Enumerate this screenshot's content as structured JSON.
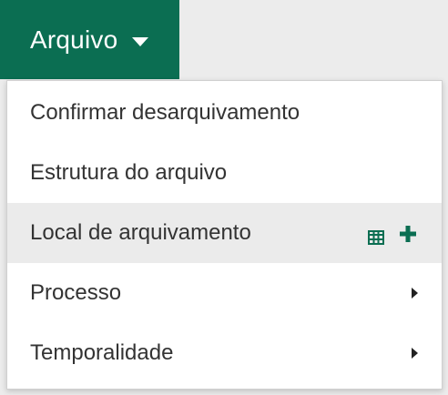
{
  "menu": {
    "toggle_label": "Arquivo",
    "items": [
      {
        "label": "Confirmar desarquivamento"
      },
      {
        "label": "Estrutura do arquivo"
      },
      {
        "label": "Local de arquivamento",
        "active": true,
        "actions": [
          "grid-icon",
          "plus-icon"
        ]
      },
      {
        "label": "Processo",
        "submenu": true
      },
      {
        "label": "Temporalidade",
        "submenu": true
      }
    ]
  },
  "colors": {
    "brand": "#0b6e52",
    "active_bg": "#ebebeb"
  }
}
